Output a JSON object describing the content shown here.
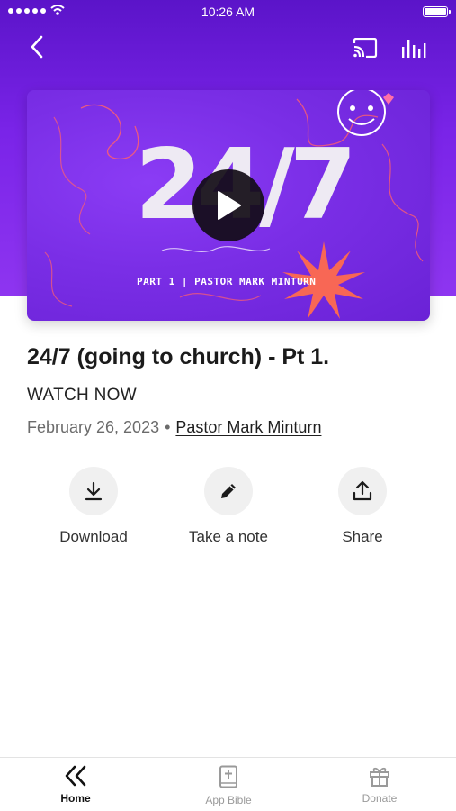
{
  "status_bar": {
    "time": "10:26 AM"
  },
  "header": {
    "back_icon": "chevron-left-icon",
    "cast_icon": "cast-icon",
    "audio_icon": "audio-bars-icon"
  },
  "video": {
    "thumbnail_title": "24/7",
    "thumbnail_subtitle": "PART 1 | PASTOR MARK MINTURN",
    "play_icon": "play-icon"
  },
  "sermon": {
    "title": "24/7 (going to church) - Pt 1.",
    "subtitle": "WATCH NOW",
    "date": "February 26, 2023",
    "separator": "•",
    "speaker": "Pastor Mark Minturn"
  },
  "actions": [
    {
      "label": "Download",
      "icon": "download-icon"
    },
    {
      "label": "Take a note",
      "icon": "pencil-icon"
    },
    {
      "label": "Share",
      "icon": "share-icon"
    }
  ],
  "tabs": [
    {
      "label": "Home",
      "icon": "double-chevron-left-icon",
      "active": true
    },
    {
      "label": "App Bible",
      "icon": "bible-icon",
      "active": false
    },
    {
      "label": "Donate",
      "icon": "gift-icon",
      "active": false
    }
  ],
  "colors": {
    "header_purple": "#6a1dd6",
    "thumbnail_purple": "#7a2ee6",
    "accent_orange": "#ff6a4d",
    "text_dark": "#1b1b1b",
    "text_muted": "#6b6b6b"
  }
}
